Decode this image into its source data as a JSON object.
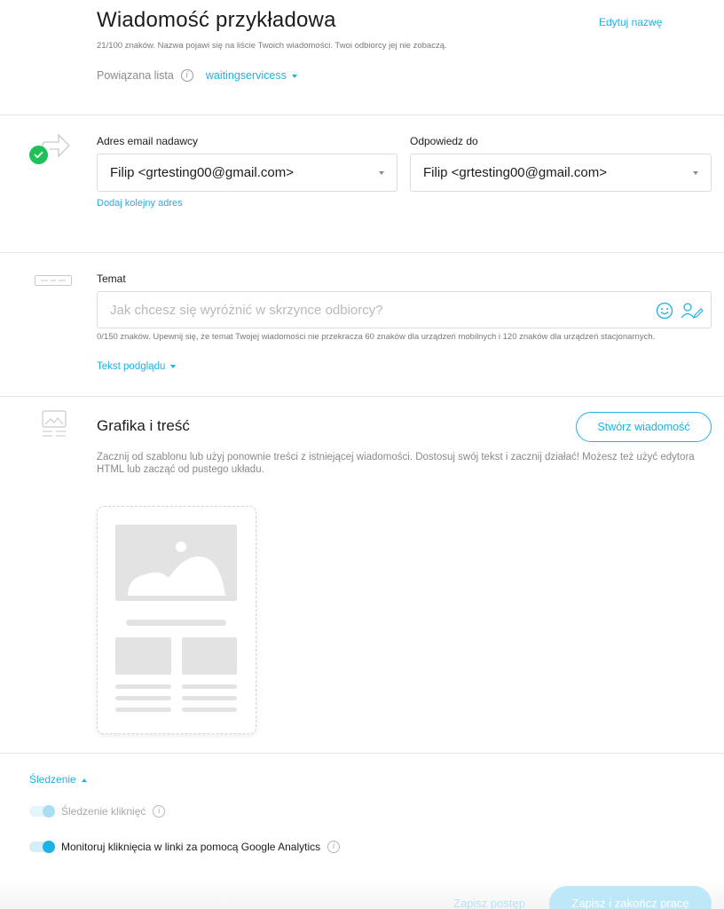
{
  "header": {
    "title": "Wiadomość przykładowa",
    "edit_link": "Edytuj nazwę",
    "name_hint": "21/100 znaków. Nazwa pojawi się na liście Twoich wiadomości. Twoi odbiorcy jej nie zobaczą.",
    "linked_list_label": "Powiązana lista",
    "linked_list_value": "waitingservicess",
    "info_glyph": "i"
  },
  "sender": {
    "from_label": "Adres email nadawcy",
    "from_value": "Filip <grtesting00@gmail.com>",
    "reply_label": "Odpowiedz do",
    "reply_value": "Filip <grtesting00@gmail.com>",
    "add_address": "Dodaj kolejny adres",
    "icon": "forward-arrow-icon"
  },
  "subject": {
    "label": "Temat",
    "placeholder": "Jak chcesz się wyróżnić w skrzynce odbiorcy?",
    "hint": "0/150 znaków. Upewnij się, że temat Twojej wiadomości nie przekracza 60 znaków dla urządzeń mobilnych i 120 znaków dla urządzeń stacjonarnych.",
    "preview_text": "Tekst podglądu",
    "icon": "subject-field-icon"
  },
  "content": {
    "title": "Grafika i treść",
    "create_button": "Stwórz wiadomość",
    "description": "Zacznij od szablonu lub użyj ponownie treści z istniejącej wiadomości. Dostosuj swój tekst i zacznij działać! Możesz też użyć edytora HTML lub zacząć od pustego układu.",
    "icon": "image-layout-icon"
  },
  "tracking": {
    "title": "Śledzenie",
    "click_tracking": "Śledzenie kliknięć",
    "click_tracking_enabled": false,
    "ga_tracking": "Monitoruj kliknięcia w linki za pomocą Google Analytics",
    "ga_tracking_enabled": true
  },
  "footer": {
    "save_draft": "Zapisz postęp",
    "save_finish": "Zapisz i zakończ pracę"
  },
  "colors": {
    "accent": "#1eb1e6",
    "success": "#1ec05a"
  }
}
